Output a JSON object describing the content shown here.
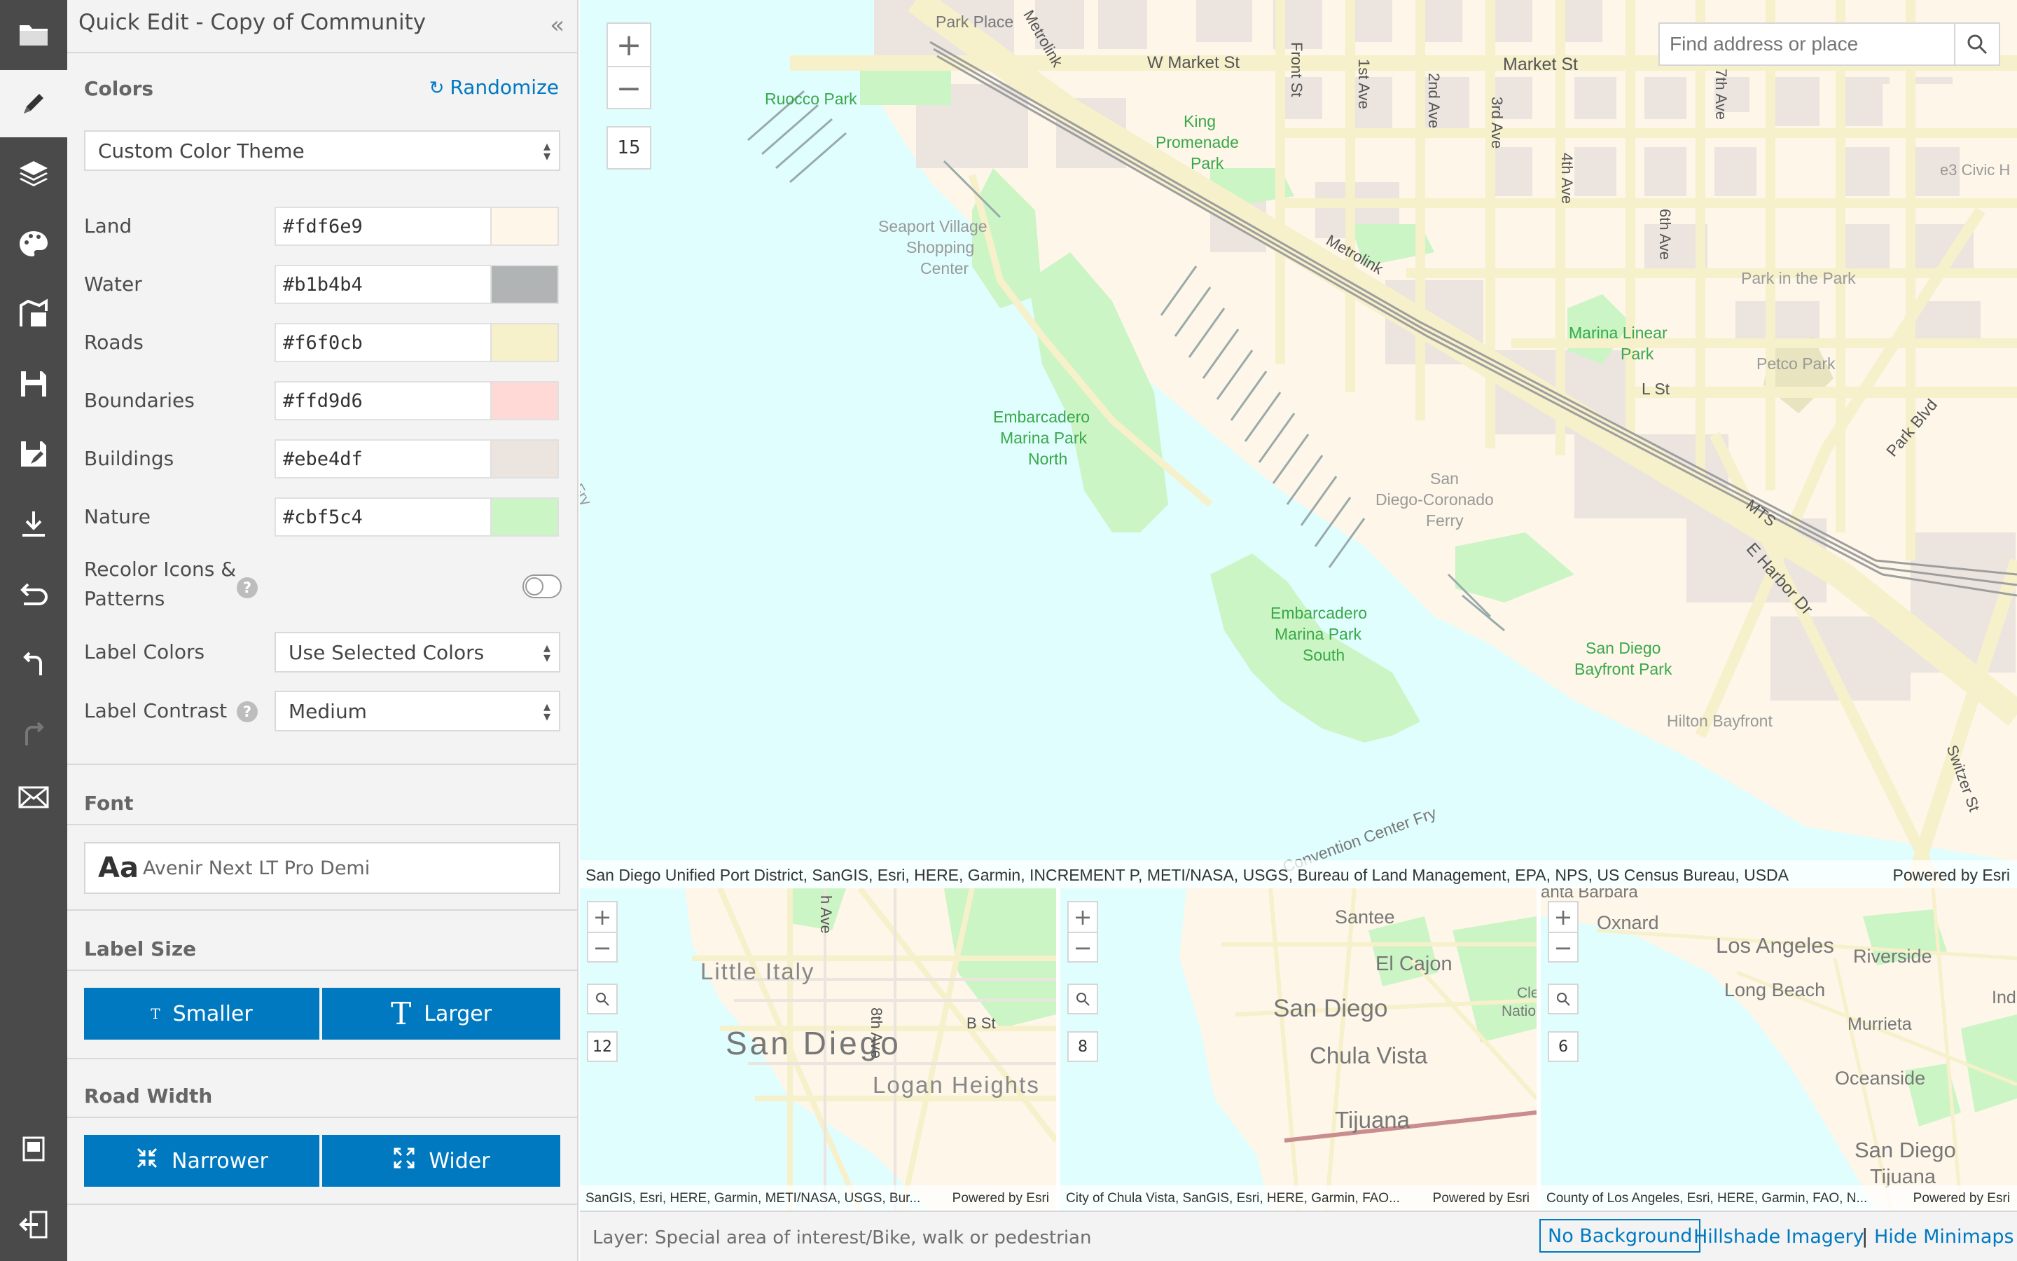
{
  "panel": {
    "title": "Quick Edit - Copy of Community",
    "collapse": "«",
    "colors_heading": "Colors",
    "randomize": "Randomize",
    "theme_select": "Custom Color Theme",
    "color_rows": [
      {
        "label": "Land",
        "value": "#fdf6e9",
        "swatch": "#fdf6e9"
      },
      {
        "label": "Water",
        "value": "#b1b4b4",
        "swatch": "#b1b4b4"
      },
      {
        "label": "Roads",
        "value": "#f6f0cb",
        "swatch": "#f6f0cb"
      },
      {
        "label": "Boundaries",
        "value": "#ffd9d6",
        "swatch": "#ffd9d6"
      },
      {
        "label": "Buildings",
        "value": "#ebe4df",
        "swatch": "#ebe4df"
      },
      {
        "label": "Nature",
        "value": "#cbf5c4",
        "swatch": "#cbf5c4"
      }
    ],
    "recolor_label_1": "Recolor Icons &",
    "recolor_label_2": "Patterns",
    "label_colors_label": "Label Colors",
    "label_colors_value": "Use Selected Colors",
    "label_contrast_label": "Label Contrast",
    "label_contrast_value": "Medium",
    "help_glyph": "?",
    "font_heading": "Font",
    "font_sample": "Aa",
    "font_name": "Avenir Next LT Pro Demi",
    "label_size_heading": "Label Size",
    "smaller": "Smaller",
    "larger": "Larger",
    "road_width_heading": "Road Width",
    "narrower": "Narrower",
    "wider": "Wider"
  },
  "map": {
    "zoom_in": "+",
    "zoom_out": "−",
    "zoom_level": "15",
    "search_placeholder": "Find address or place",
    "attribution": "San Diego Unified Port District, SanGIS, Esri, HERE, Garmin, INCREMENT P, METI/NASA, USGS, Bureau of Land Management, EPA, NPS, US Census Bureau, USDA",
    "powered_by": "Powered by Esri",
    "labels": {
      "park_place": "Park Place",
      "w_market": "W Market St",
      "market": "Market St",
      "ruocco": "Ruocco Park",
      "king1": "King",
      "king2": "Promenade",
      "king3": "Park",
      "seaport1": "Seaport Village",
      "seaport2": "Shopping",
      "seaport3": "Center",
      "metrolink": "Metrolink",
      "front": "Front St",
      "first": "1st Ave",
      "second": "2nd Ave",
      "third": "3rd Ave",
      "fourth": "4th Ave",
      "sixth": "6th Ave",
      "seventh": "7th Ave",
      "e3": "e3 Civic H",
      "park_in_park": "Park in the Park",
      "petco": "Petco Park",
      "marina_linear1": "Marina Linear",
      "marina_linear2": "Park",
      "lst": "L St",
      "emb_n1": "Embarcadero",
      "emb_n2": "Marina Park",
      "emb_n3": "North",
      "ferry1": "San",
      "ferry2": "Diego-Coronado",
      "ferry3": "Ferry",
      "emb_s1": "Embarcadero",
      "emb_s2": "Marina Park",
      "emb_s3": "South",
      "bayfront1": "San Diego",
      "bayfront2": "Bayfront Park",
      "hilton": "Hilton Bayfront",
      "mts": "MTS",
      "harbor": "E Harbor Dr",
      "park_blvd": "Park Blvd",
      "convention": "Convention Center Fry",
      "switzer": "Switzer St",
      "fry": "Fry"
    }
  },
  "minimaps": [
    {
      "zoom": "12",
      "attribution": "SanGIS, Esri, HERE, Garmin, METI/NASA, USGS, Bur...",
      "powered_by": "Powered by Esri",
      "labels": {
        "little_italy": "Little Italy",
        "san_diego": "San Diego",
        "logan": "Logan Heights",
        "bst": "B St",
        "ave": "h Ave",
        "eighth": "8th Ave"
      }
    },
    {
      "zoom": "8",
      "attribution": "City of Chula Vista, SanGIS, Esri, HERE, Garmin, FAO...",
      "powered_by": "Powered by Esri",
      "labels": {
        "santee": "Santee",
        "el_cajon": "El Cajon",
        "san_diego": "San Diego",
        "chula": "Chula Vista",
        "tijuana": "Tijuana",
        "cle": "Cle",
        "natio": "Natio"
      }
    },
    {
      "zoom": "6",
      "attribution": "County of Los Angeles, Esri, HERE, Garmin, FAO, N...",
      "powered_by": "Powered by Esri",
      "labels": {
        "santa_barbara": "anta Barbara",
        "oxnard": "Oxnard",
        "la": "Los Angeles",
        "riverside": "Riverside",
        "long_beach": "Long Beach",
        "indio": "Indio",
        "murrieta": "Murrieta",
        "oceanside": "Oceanside",
        "san_diego": "San Diego",
        "tijuana": "Tijuana"
      }
    }
  ],
  "status": {
    "layer": "Layer: Special area of interest/Bike, walk or pedestrian",
    "no_background": "No Background",
    "hillshade": "Hillshade",
    "imagery": "Imagery",
    "separator": "|",
    "hide_minimaps": "Hide Minimaps"
  },
  "colors": {
    "accent": "#0079c1",
    "water": "#e0fefe",
    "land": "#fdf6e9",
    "roads": "#f6f0cb",
    "buildings": "#ebe4df",
    "nature": "#cbf5c4",
    "sidebar": "#4a4a4a"
  }
}
